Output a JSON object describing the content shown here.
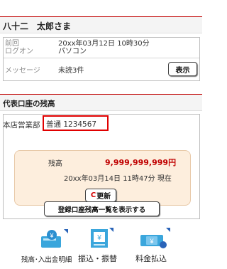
{
  "header": {
    "user_name": "八十二　太郎さま"
  },
  "login_info": {
    "last_login_label_1": "前回",
    "last_login_label_2": "ログオン",
    "last_login_datetime": "20xx年03月12日 10時30分",
    "last_login_device": "パソコン",
    "message_label": "メッセージ",
    "message_value": "未読3件",
    "show_button": "表示"
  },
  "account": {
    "section_title": "代表口座の残高",
    "branch": "本店営業部",
    "account_type_number": "普通 1234567",
    "balance_label": "残高",
    "balance_value": "9,999,999,999円",
    "as_of": "20xx年03月14日 11時47分 現在",
    "refresh_c": "C",
    "refresh_label": "更新",
    "list_button": "登録口座残高一覧を表示する"
  },
  "quick_menu": {
    "items": [
      {
        "label": "残高･入出金明細",
        "icon": "passbook-coin-icon"
      },
      {
        "label": "振込・振替",
        "icon": "atm-transfer-icon"
      },
      {
        "label": "料金払込",
        "icon": "bill-payment-icon"
      }
    ]
  },
  "colors": {
    "accent": "#c00000",
    "highlight_border": "#e00000",
    "icon_blue": "#2aa0d8",
    "panel": "#fdeedd"
  }
}
